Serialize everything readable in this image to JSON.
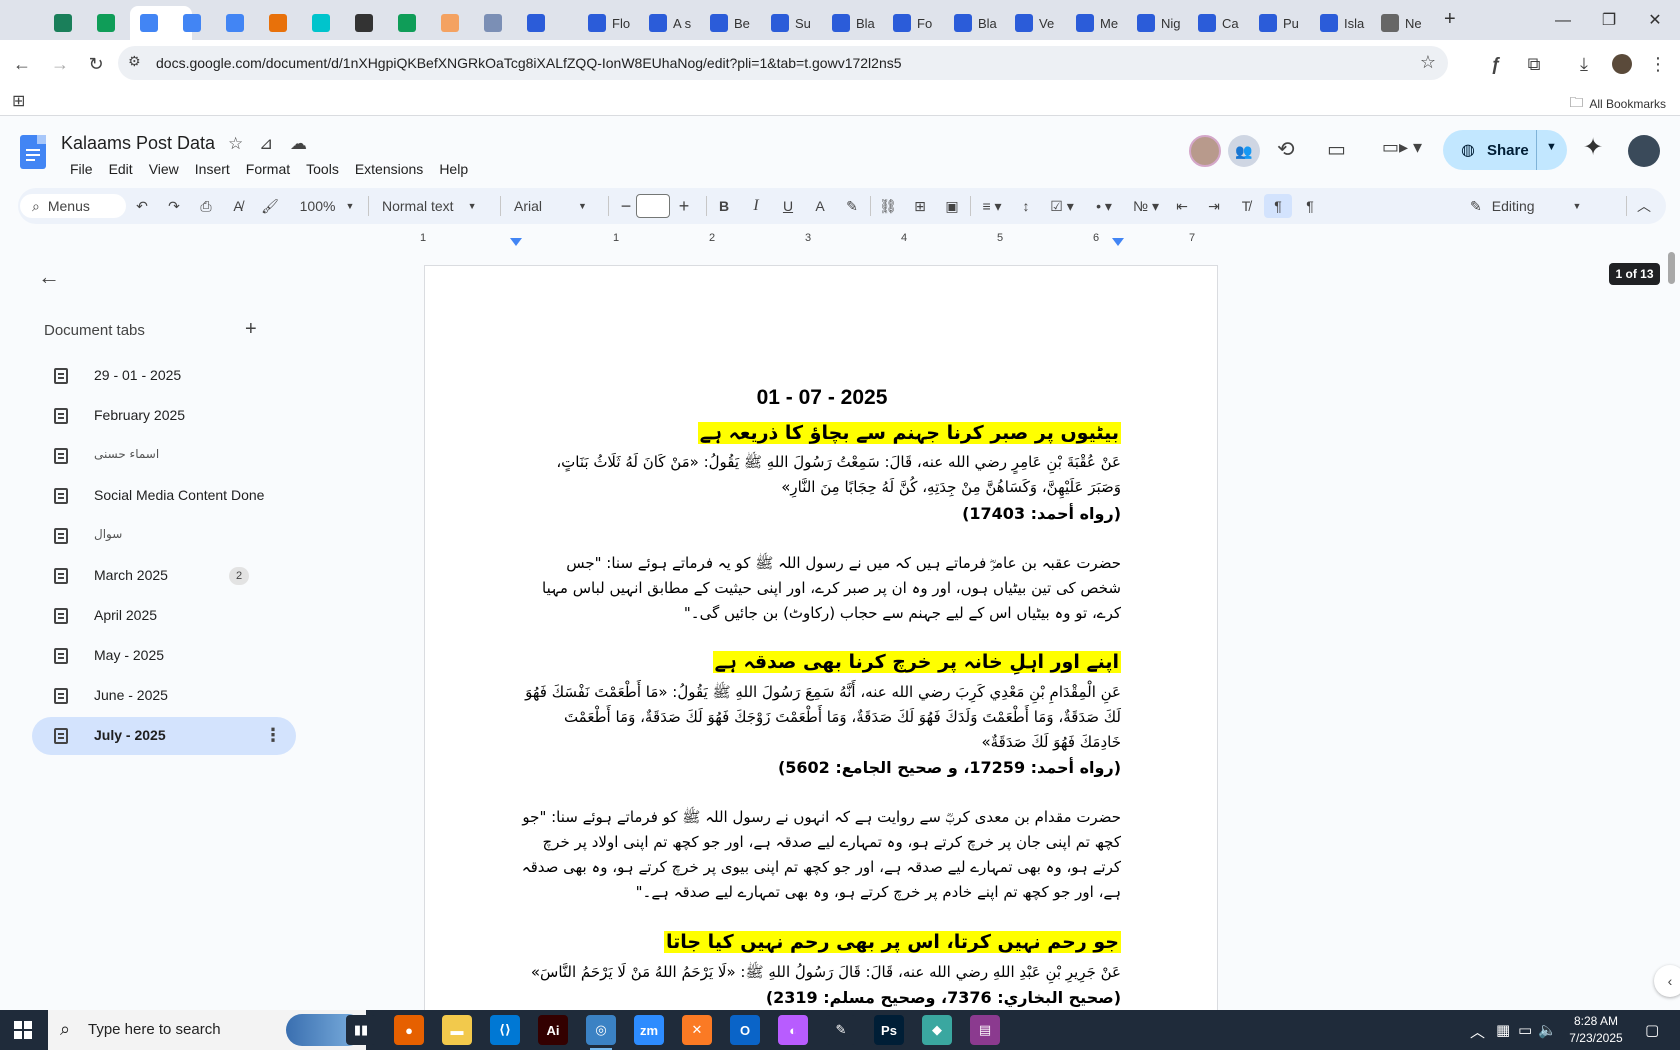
{
  "browser": {
    "tabs": [
      {
        "icon": "whatsapp-icon",
        "color": "#1a7f5a",
        "label": ""
      },
      {
        "icon": "sheets-icon",
        "color": "#0f9d58",
        "label": ""
      },
      {
        "icon": "docs-icon",
        "color": "#4285f4",
        "label": "",
        "active": true
      },
      {
        "icon": "docs-icon",
        "color": "#4285f4",
        "label": ""
      },
      {
        "icon": "docs-icon",
        "color": "#4285f4",
        "label": ""
      },
      {
        "icon": "image-icon",
        "color": "#e8710a",
        "label": ""
      },
      {
        "icon": "canva-icon",
        "color": "#00c4cc",
        "label": ""
      },
      {
        "icon": "chatgpt-icon",
        "color": "#333333",
        "label": ""
      },
      {
        "icon": "sheets-icon",
        "color": "#0f9d58",
        "label": ""
      },
      {
        "icon": "calligraphy-icon",
        "color": "#f4a261",
        "label": ""
      },
      {
        "icon": "grid-icon",
        "color": "#7b8fb5",
        "label": ""
      },
      {
        "icon": "forms-icon",
        "color": "#2b5cd9",
        "label": ""
      },
      {
        "icon": "forms-icon",
        "color": "#2b5cd9",
        "label": "Flo"
      },
      {
        "icon": "forms-icon",
        "color": "#2b5cd9",
        "label": "A s"
      },
      {
        "icon": "forms-icon",
        "color": "#2b5cd9",
        "label": "Be"
      },
      {
        "icon": "forms-icon",
        "color": "#2b5cd9",
        "label": "Su"
      },
      {
        "icon": "forms-icon",
        "color": "#2b5cd9",
        "label": "Bla"
      },
      {
        "icon": "forms-icon",
        "color": "#2b5cd9",
        "label": "Fo"
      },
      {
        "icon": "forms-icon",
        "color": "#2b5cd9",
        "label": "Bla"
      },
      {
        "icon": "forms-icon",
        "color": "#2b5cd9",
        "label": "Ve"
      },
      {
        "icon": "forms-icon",
        "color": "#2b5cd9",
        "label": "Me"
      },
      {
        "icon": "forms-icon",
        "color": "#2b5cd9",
        "label": "Nig"
      },
      {
        "icon": "forms-icon",
        "color": "#2b5cd9",
        "label": "Ca"
      },
      {
        "icon": "forms-icon",
        "color": "#2b5cd9",
        "label": "Pu"
      },
      {
        "icon": "forms-icon",
        "color": "#2b5cd9",
        "label": "Isla"
      },
      {
        "icon": "chrome-icon",
        "color": "#666666",
        "label": "Ne"
      }
    ],
    "new_tab": "+",
    "url": "docs.google.com/document/d/1nXHgpiQKBefXNGRkOaTcg8iXALfZQQ-IonW8EUhaNog/edit?pli=1&tab=t.gowv172l2ns5",
    "all_bookmarks": "All Bookmarks"
  },
  "docs": {
    "title": "Kalaams Post Data",
    "menu": [
      "File",
      "Edit",
      "View",
      "Insert",
      "Format",
      "Tools",
      "Extensions",
      "Help"
    ],
    "share_label": "Share",
    "toolbar": {
      "menus_search": "Menus",
      "zoom": "100%",
      "style": "Normal text",
      "font": "Arial",
      "font_size": "",
      "mode": "Editing"
    },
    "ruler_numbers": [
      "1",
      "1",
      "2",
      "3",
      "4",
      "5",
      "6",
      "7"
    ],
    "page_count": "1 of 13"
  },
  "sidebar": {
    "heading": "Document tabs",
    "tabs": [
      {
        "label": "29 - 01 - 2025"
      },
      {
        "label": "February 2025"
      },
      {
        "label": "اسماء حسنی",
        "small": true
      },
      {
        "label": "Social Media Content Done"
      },
      {
        "label": "سوال",
        "small": true
      },
      {
        "label": "March 2025",
        "badge": "2"
      },
      {
        "label": "April 2025"
      },
      {
        "label": "May - 2025"
      },
      {
        "label": "June - 2025"
      },
      {
        "label": "July - 2025",
        "selected": true
      }
    ]
  },
  "page": {
    "date": "01 - 07 - 2025",
    "sections": [
      {
        "heading": "بیٹیوں پر صبر کرنا جہنم سے بچاؤ کا ذریعہ ہے",
        "arabic": "عَنْ عُقْبَةَ بْنِ عَامِرٍ رضي الله عنه، قَالَ: سَمِعْتُ رَسُولَ اللهِ ﷺ يَقُولُ: «مَنْ كَانَ لَهُ ثَلَاثُ بَنَاتٍ، وَصَبَرَ عَلَيْهِنَّ، وَكَسَاهُنَّ مِنْ جِدَتِهِ، كُنَّ لَهُ حِجَابًا مِنَ النَّارِ»",
        "reference": "(رواه أحمد: 17403)",
        "urdu": "حضرت عقبہ بن عامرؓ فرماتے ہیں کہ میں نے رسول اللہ ﷺ کو یہ فرماتے ہوئے سنا: \"جس شخص کی تین بیٹیاں ہوں، اور وہ ان پر صبر کرے، اور اپنی حیثیت کے مطابق انہیں لباس مہیا کرے، تو وہ بیٹیاں اس کے لیے جہنم سے حجاب (رکاوٹ) بن جائیں گی۔\""
      },
      {
        "heading": "اپنے اور اہلِ خانہ پر خرچ کرنا بھی صدقہ ہے",
        "arabic": "عَنِ الْمِقْدَامِ بْنِ مَعْدِي كَرِبَ رضي الله عنه، أَنَّهُ سَمِعَ رَسُولَ اللهِ ﷺ يَقُولُ: «مَا أَطْعَمْتَ نَفْسَكَ فَهُوَ لَكَ صَدَقَةٌ، وَمَا أَطْعَمْتَ وَلَدَكَ فَهُوَ لَكَ صَدَقَةٌ، وَمَا أَطْعَمْتَ زَوْجَكَ فَهُوَ لَكَ صَدَقَةٌ، وَمَا أَطْعَمْتَ خَادِمَكَ فَهُوَ لَكَ صَدَقَةٌ»",
        "reference": "(رواه أحمد: 17259، و صحيح الجامع: 5602)",
        "urdu": "حضرت مقدام بن معدی کربؓ سے روایت ہے کہ انہوں نے رسول اللہ ﷺ کو فرماتے ہوئے سنا: \"جو کچھ تم اپنی جان پر خرچ کرتے ہو، وہ تمہارے لیے صدقہ ہے، اور جو کچھ تم اپنی اولاد پر خرچ کرتے ہو، وہ بھی تمہارے لیے صدقہ ہے، اور جو کچھ تم اپنی بیوی پر خرچ کرتے ہو، وہ بھی صدقہ ہے، اور جو کچھ تم اپنے خادم پر خرچ کرتے ہو، وہ بھی تمہارے لیے صدقہ ہے۔\""
      },
      {
        "heading": "جو رحم نہیں کرتا، اس پر بھی رحم نہیں کیا جاتا",
        "arabic": "عَنْ جَرِيرِ بْنِ عَبْدِ اللهِ رضي الله عنه، قَالَ: قَالَ رَسُولُ اللهِ ﷺ: «لَا يَرْحَمُ اللهُ مَنْ لَا يَرْحَمُ النَّاسَ»",
        "reference": "(صحيح البخاري: 7376، وصحيح مسلم: 2319)"
      }
    ]
  },
  "taskbar": {
    "search_placeholder": "Type here to search",
    "apps": [
      {
        "icon": "task-view-icon",
        "color": "#1f2b3a",
        "text": "▮▮"
      },
      {
        "icon": "firefox-icon",
        "color": "#e66000",
        "text": "●"
      },
      {
        "icon": "file-explorer-icon",
        "color": "#f2c94c",
        "text": "▬"
      },
      {
        "icon": "vscode-icon",
        "color": "#0078d4",
        "text": "⟨⟩"
      },
      {
        "icon": "illustrator-icon",
        "color": "#330000",
        "text": "Ai"
      },
      {
        "icon": "chrome-icon",
        "color": "#3b82c4",
        "text": "◎",
        "active": true
      },
      {
        "icon": "zoom-icon",
        "color": "#2d8cff",
        "text": "zm"
      },
      {
        "icon": "xampp-icon",
        "color": "#fb7a24",
        "text": "✕"
      },
      {
        "icon": "outlook-icon",
        "color": "#0a64c8",
        "text": "O"
      },
      {
        "icon": "photos-icon",
        "color": "#b85cff",
        "text": "◐"
      },
      {
        "icon": "pen-icon",
        "color": "#1f2b3a",
        "text": "✎"
      },
      {
        "icon": "photoshop-icon",
        "color": "#001e36",
        "text": "Ps"
      },
      {
        "icon": "app-icon",
        "color": "#3aa7a0",
        "text": "◆"
      },
      {
        "icon": "winrar-icon",
        "color": "#8b3a8f",
        "text": "▤"
      }
    ],
    "time": "8:28 AM",
    "date": "7/23/2025"
  }
}
